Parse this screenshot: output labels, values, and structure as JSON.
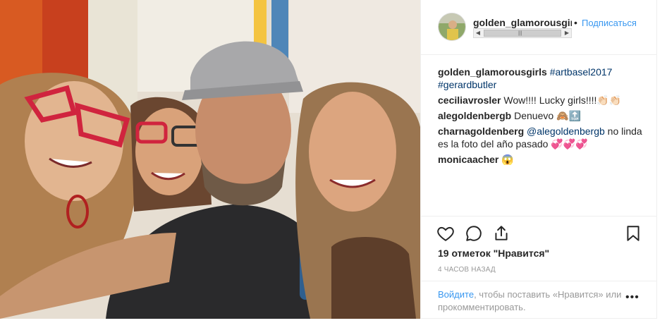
{
  "post": {
    "username": "golden_glamorousgirls",
    "dot": "•",
    "follow_label": "Подписаться",
    "scroll_grip": "|||"
  },
  "caption": {
    "username": "golden_glamorousgirls",
    "tag1": "#artbasel2017",
    "tag2": "#gerardbutler"
  },
  "comments": [
    {
      "user": "ceciliavrosler",
      "text": "Wow!!!! Lucky girls!!!!",
      "emoji": "👏🏻👏🏻"
    },
    {
      "user": "alegoldenbergb",
      "text": "Denuevo",
      "emoji": "🙈🔝"
    },
    {
      "user": "charnagoldenberg",
      "mention": "@alegoldenbergb",
      "text": "no linda es la foto del año pasado",
      "emoji": "💞💞💞"
    },
    {
      "user": "monicaacher",
      "text": "",
      "emoji": "😱"
    }
  ],
  "likes_text": "19 отметок \"Нравится\"",
  "time_ago": "4 часов назад",
  "footer": {
    "login_link": "Войдите",
    "login_rest": ", чтобы поставить «Нравится» или прокомментировать.",
    "more": "•••"
  },
  "icons": {
    "like": "heart-icon",
    "comment": "comment-icon",
    "share": "share-icon",
    "save": "bookmark-icon"
  },
  "colors": {
    "link_blue": "#3897f0",
    "hashtag_blue": "#003569",
    "muted": "#999999"
  }
}
